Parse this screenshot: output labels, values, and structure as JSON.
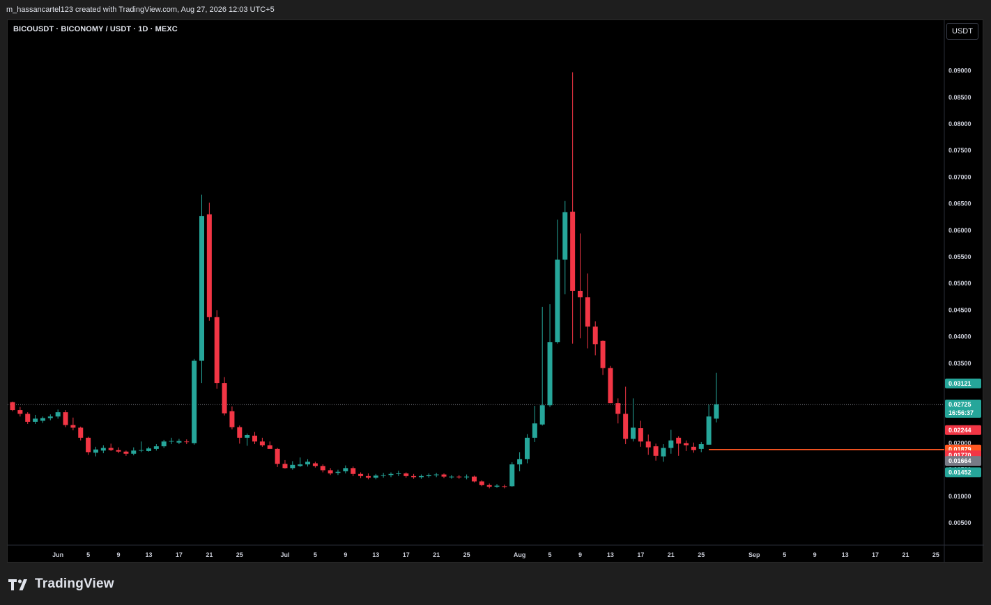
{
  "header": {
    "caption": "m_hassancartel123 created with TradingView.com, Aug 27, 2026 12:03 UTC+5"
  },
  "chart": {
    "symbol_title": "BICOUSDT · BICONOMY / USDT · 1D · MEXC",
    "currency_button": "USDT"
  },
  "footer": {
    "brand": "TradingView"
  },
  "colors": {
    "up": "#26a69a",
    "down": "#f23645",
    "background": "#000000",
    "level_line": "#f7525f",
    "level_badge": "#ff5722"
  },
  "chart_data": {
    "type": "candlestick",
    "title": "BICOUSDT · BICONOMY / USDT · 1D · MEXC",
    "price_unit": "USDT",
    "ylim": [
      0.002,
      0.094
    ],
    "y_ticks": [
      "0.00500",
      "0.01000",
      "0.01500",
      "0.02000",
      "0.03500",
      "0.04000",
      "0.04500",
      "0.05000",
      "0.05500",
      "0.06000",
      "0.06500",
      "0.07000",
      "0.07500",
      "0.08000",
      "0.08500",
      "0.09000"
    ],
    "x_ticks": [
      {
        "label": "Jun",
        "idx": 6
      },
      {
        "label": "5",
        "idx": 10
      },
      {
        "label": "9",
        "idx": 14
      },
      {
        "label": "13",
        "idx": 18
      },
      {
        "label": "17",
        "idx": 22
      },
      {
        "label": "21",
        "idx": 26
      },
      {
        "label": "25",
        "idx": 30
      },
      {
        "label": "Jul",
        "idx": 36
      },
      {
        "label": "5",
        "idx": 40
      },
      {
        "label": "9",
        "idx": 44
      },
      {
        "label": "13",
        "idx": 48
      },
      {
        "label": "17",
        "idx": 52
      },
      {
        "label": "21",
        "idx": 56
      },
      {
        "label": "25",
        "idx": 60
      },
      {
        "label": "Aug",
        "idx": 67
      },
      {
        "label": "5",
        "idx": 71
      },
      {
        "label": "9",
        "idx": 75
      },
      {
        "label": "13",
        "idx": 79
      },
      {
        "label": "17",
        "idx": 83
      },
      {
        "label": "21",
        "idx": 87
      },
      {
        "label": "25",
        "idx": 91
      },
      {
        "label": "Sep",
        "idx": 98
      },
      {
        "label": "5",
        "idx": 102
      },
      {
        "label": "9",
        "idx": 106
      },
      {
        "label": "13",
        "idx": 110
      },
      {
        "label": "17",
        "idx": 114
      },
      {
        "label": "21",
        "idx": 118
      },
      {
        "label": "25",
        "idx": 122
      }
    ],
    "candles": [
      [
        0.0277,
        0.0278,
        0.026,
        0.0262
      ],
      [
        0.0262,
        0.0268,
        0.025,
        0.0255
      ],
      [
        0.0255,
        0.0258,
        0.0236,
        0.024
      ],
      [
        0.024,
        0.0253,
        0.0236,
        0.0246
      ],
      [
        0.0242,
        0.025,
        0.0238,
        0.0247
      ],
      [
        0.0247,
        0.0254,
        0.0243,
        0.025
      ],
      [
        0.025,
        0.0263,
        0.0246,
        0.0258
      ],
      [
        0.0258,
        0.0262,
        0.023,
        0.0234
      ],
      [
        0.0234,
        0.0248,
        0.0224,
        0.0229
      ],
      [
        0.0229,
        0.0231,
        0.0205,
        0.021
      ],
      [
        0.021,
        0.0212,
        0.0178,
        0.0183
      ],
      [
        0.0182,
        0.0193,
        0.0175,
        0.0188
      ],
      [
        0.0186,
        0.0196,
        0.0181,
        0.0191
      ],
      [
        0.0191,
        0.0199,
        0.0185,
        0.0187
      ],
      [
        0.0187,
        0.0192,
        0.0181,
        0.0184
      ],
      [
        0.0184,
        0.0186,
        0.0176,
        0.018
      ],
      [
        0.018,
        0.0192,
        0.0177,
        0.0186
      ],
      [
        0.0186,
        0.0203,
        0.0183,
        0.0187
      ],
      [
        0.0185,
        0.0193,
        0.0184,
        0.019
      ],
      [
        0.0189,
        0.0198,
        0.0186,
        0.0194
      ],
      [
        0.0194,
        0.0206,
        0.0191,
        0.0203
      ],
      [
        0.0203,
        0.021,
        0.0198,
        0.0204
      ],
      [
        0.0201,
        0.0208,
        0.0198,
        0.0204
      ],
      [
        0.0203,
        0.0207,
        0.0198,
        0.0202
      ],
      [
        0.02,
        0.0358,
        0.0197,
        0.0355
      ],
      [
        0.0355,
        0.0667,
        0.0313,
        0.0627
      ],
      [
        0.063,
        0.0652,
        0.043,
        0.0437
      ],
      [
        0.0437,
        0.045,
        0.0302,
        0.0313
      ],
      [
        0.0313,
        0.0324,
        0.0252,
        0.0256
      ],
      [
        0.026,
        0.0269,
        0.0226,
        0.023
      ],
      [
        0.023,
        0.0233,
        0.0199,
        0.021
      ],
      [
        0.021,
        0.0218,
        0.0195,
        0.0215
      ],
      [
        0.0214,
        0.0221,
        0.0198,
        0.0203
      ],
      [
        0.0203,
        0.021,
        0.0193,
        0.0196
      ],
      [
        0.0196,
        0.0203,
        0.0191,
        0.0189
      ],
      [
        0.0189,
        0.0191,
        0.0155,
        0.0161
      ],
      [
        0.0161,
        0.0168,
        0.0152,
        0.0153
      ],
      [
        0.0153,
        0.0166,
        0.015,
        0.0159
      ],
      [
        0.0157,
        0.0173,
        0.0155,
        0.016
      ],
      [
        0.016,
        0.017,
        0.0156,
        0.0165
      ],
      [
        0.0162,
        0.0165,
        0.0154,
        0.0157
      ],
      [
        0.0157,
        0.016,
        0.0145,
        0.0149
      ],
      [
        0.0149,
        0.0153,
        0.014,
        0.0143
      ],
      [
        0.0144,
        0.015,
        0.014,
        0.0146
      ],
      [
        0.0147,
        0.0158,
        0.0143,
        0.0153
      ],
      [
        0.0153,
        0.0156,
        0.0138,
        0.0142
      ],
      [
        0.0142,
        0.0145,
        0.0134,
        0.0138
      ],
      [
        0.0138,
        0.0143,
        0.0132,
        0.0135
      ],
      [
        0.0135,
        0.0142,
        0.0132,
        0.0139
      ],
      [
        0.0139,
        0.0144,
        0.0135,
        0.014
      ],
      [
        0.014,
        0.0145,
        0.0136,
        0.0142
      ],
      [
        0.0142,
        0.0148,
        0.0138,
        0.0143
      ],
      [
        0.0143,
        0.0145,
        0.0135,
        0.0138
      ],
      [
        0.0138,
        0.0142,
        0.0133,
        0.0136
      ],
      [
        0.0136,
        0.0141,
        0.0133,
        0.0138
      ],
      [
        0.0138,
        0.0143,
        0.0135,
        0.014
      ],
      [
        0.014,
        0.0144,
        0.0136,
        0.0141
      ],
      [
        0.0141,
        0.0143,
        0.0134,
        0.0137
      ],
      [
        0.0137,
        0.014,
        0.0133,
        0.0137
      ],
      [
        0.0137,
        0.014,
        0.0133,
        0.0136
      ],
      [
        0.0136,
        0.0141,
        0.0132,
        0.0137
      ],
      [
        0.0137,
        0.0139,
        0.0126,
        0.0128
      ],
      [
        0.0128,
        0.013,
        0.0119,
        0.0121
      ],
      [
        0.0121,
        0.0124,
        0.0115,
        0.0118
      ],
      [
        0.0118,
        0.0123,
        0.0116,
        0.012
      ],
      [
        0.0119,
        0.0122,
        0.0115,
        0.0118
      ],
      [
        0.0119,
        0.0164,
        0.0118,
        0.016
      ],
      [
        0.016,
        0.0183,
        0.0147,
        0.017
      ],
      [
        0.017,
        0.0217,
        0.0162,
        0.021
      ],
      [
        0.021,
        0.027,
        0.0202,
        0.0237
      ],
      [
        0.0235,
        0.0456,
        0.0233,
        0.0271
      ],
      [
        0.0271,
        0.0461,
        0.0268,
        0.039
      ],
      [
        0.039,
        0.062,
        0.0387,
        0.0545
      ],
      [
        0.0545,
        0.0655,
        0.048,
        0.0634
      ],
      [
        0.0635,
        0.0897,
        0.0387,
        0.0486
      ],
      [
        0.0486,
        0.0594,
        0.0397,
        0.0474
      ],
      [
        0.0474,
        0.0519,
        0.0378,
        0.0419
      ],
      [
        0.0419,
        0.0429,
        0.0365,
        0.0386
      ],
      [
        0.0392,
        0.0393,
        0.0328,
        0.0341
      ],
      [
        0.0341,
        0.0345,
        0.0275,
        0.0275
      ],
      [
        0.0275,
        0.0284,
        0.0237,
        0.0255
      ],
      [
        0.0255,
        0.0306,
        0.0198,
        0.0208
      ],
      [
        0.0208,
        0.0284,
        0.0203,
        0.0229
      ],
      [
        0.0228,
        0.0242,
        0.0193,
        0.0203
      ],
      [
        0.0203,
        0.0216,
        0.0178,
        0.0192
      ],
      [
        0.0194,
        0.0199,
        0.0167,
        0.0176
      ],
      [
        0.0175,
        0.0198,
        0.0165,
        0.0191
      ],
      [
        0.0191,
        0.0225,
        0.018,
        0.0205
      ],
      [
        0.021,
        0.0213,
        0.0176,
        0.0199
      ],
      [
        0.02,
        0.0205,
        0.0185,
        0.0196
      ],
      [
        0.0193,
        0.0201,
        0.0182,
        0.0187
      ],
      [
        0.0189,
        0.0202,
        0.0183,
        0.0198
      ],
      [
        0.0197,
        0.0272,
        0.0197,
        0.025
      ],
      [
        0.0246,
        0.0332,
        0.0239,
        0.0273
      ]
    ],
    "current_price_line": 0.02725,
    "horizontal_level": {
      "price": 0.01879,
      "start_idx": 92
    },
    "price_badges": [
      {
        "label": "0.03121",
        "price": 0.03121,
        "color": "#26a69a",
        "sub": ""
      },
      {
        "label": "0.02725",
        "price": 0.02725,
        "color": "#26a69a",
        "sub": "16:56:37"
      },
      {
        "label": "0.02244",
        "price": 0.02244,
        "color": "#f23645",
        "sub": ""
      },
      {
        "label": "0.01879",
        "price": 0.01879,
        "color": "#ff5722",
        "sub": ""
      },
      {
        "label": "0.01770",
        "price": 0.0177,
        "color": "#f23645",
        "sub": ""
      },
      {
        "label": "0.01664",
        "price": 0.01664,
        "color": "#787b86",
        "sub": ""
      },
      {
        "label": "0.01452",
        "price": 0.01452,
        "color": "#26a69a",
        "sub": ""
      }
    ]
  }
}
